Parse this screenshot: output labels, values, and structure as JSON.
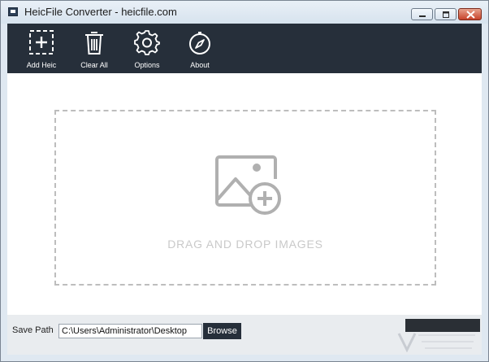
{
  "window": {
    "title": "HeicFile Converter - heicfile.com"
  },
  "toolbar": {
    "items": [
      {
        "label": "Add Heic",
        "icon": "add-file-icon"
      },
      {
        "label": "Clear All",
        "icon": "trash-icon"
      },
      {
        "label": "Options",
        "icon": "gear-icon"
      },
      {
        "label": "About",
        "icon": "compass-icon"
      }
    ]
  },
  "dropzone": {
    "text": "DRAG AND DROP IMAGES",
    "icon": "add-image-icon"
  },
  "bottombar": {
    "save_path_label": "Save Path",
    "save_path_value": "C:\\Users\\Administrator\\Desktop",
    "browse_label": "Browse"
  },
  "colors": {
    "toolbar_bg": "#262f3a",
    "dropzone_border": "#bdbdbd",
    "drop_text": "#c9c9c9"
  }
}
